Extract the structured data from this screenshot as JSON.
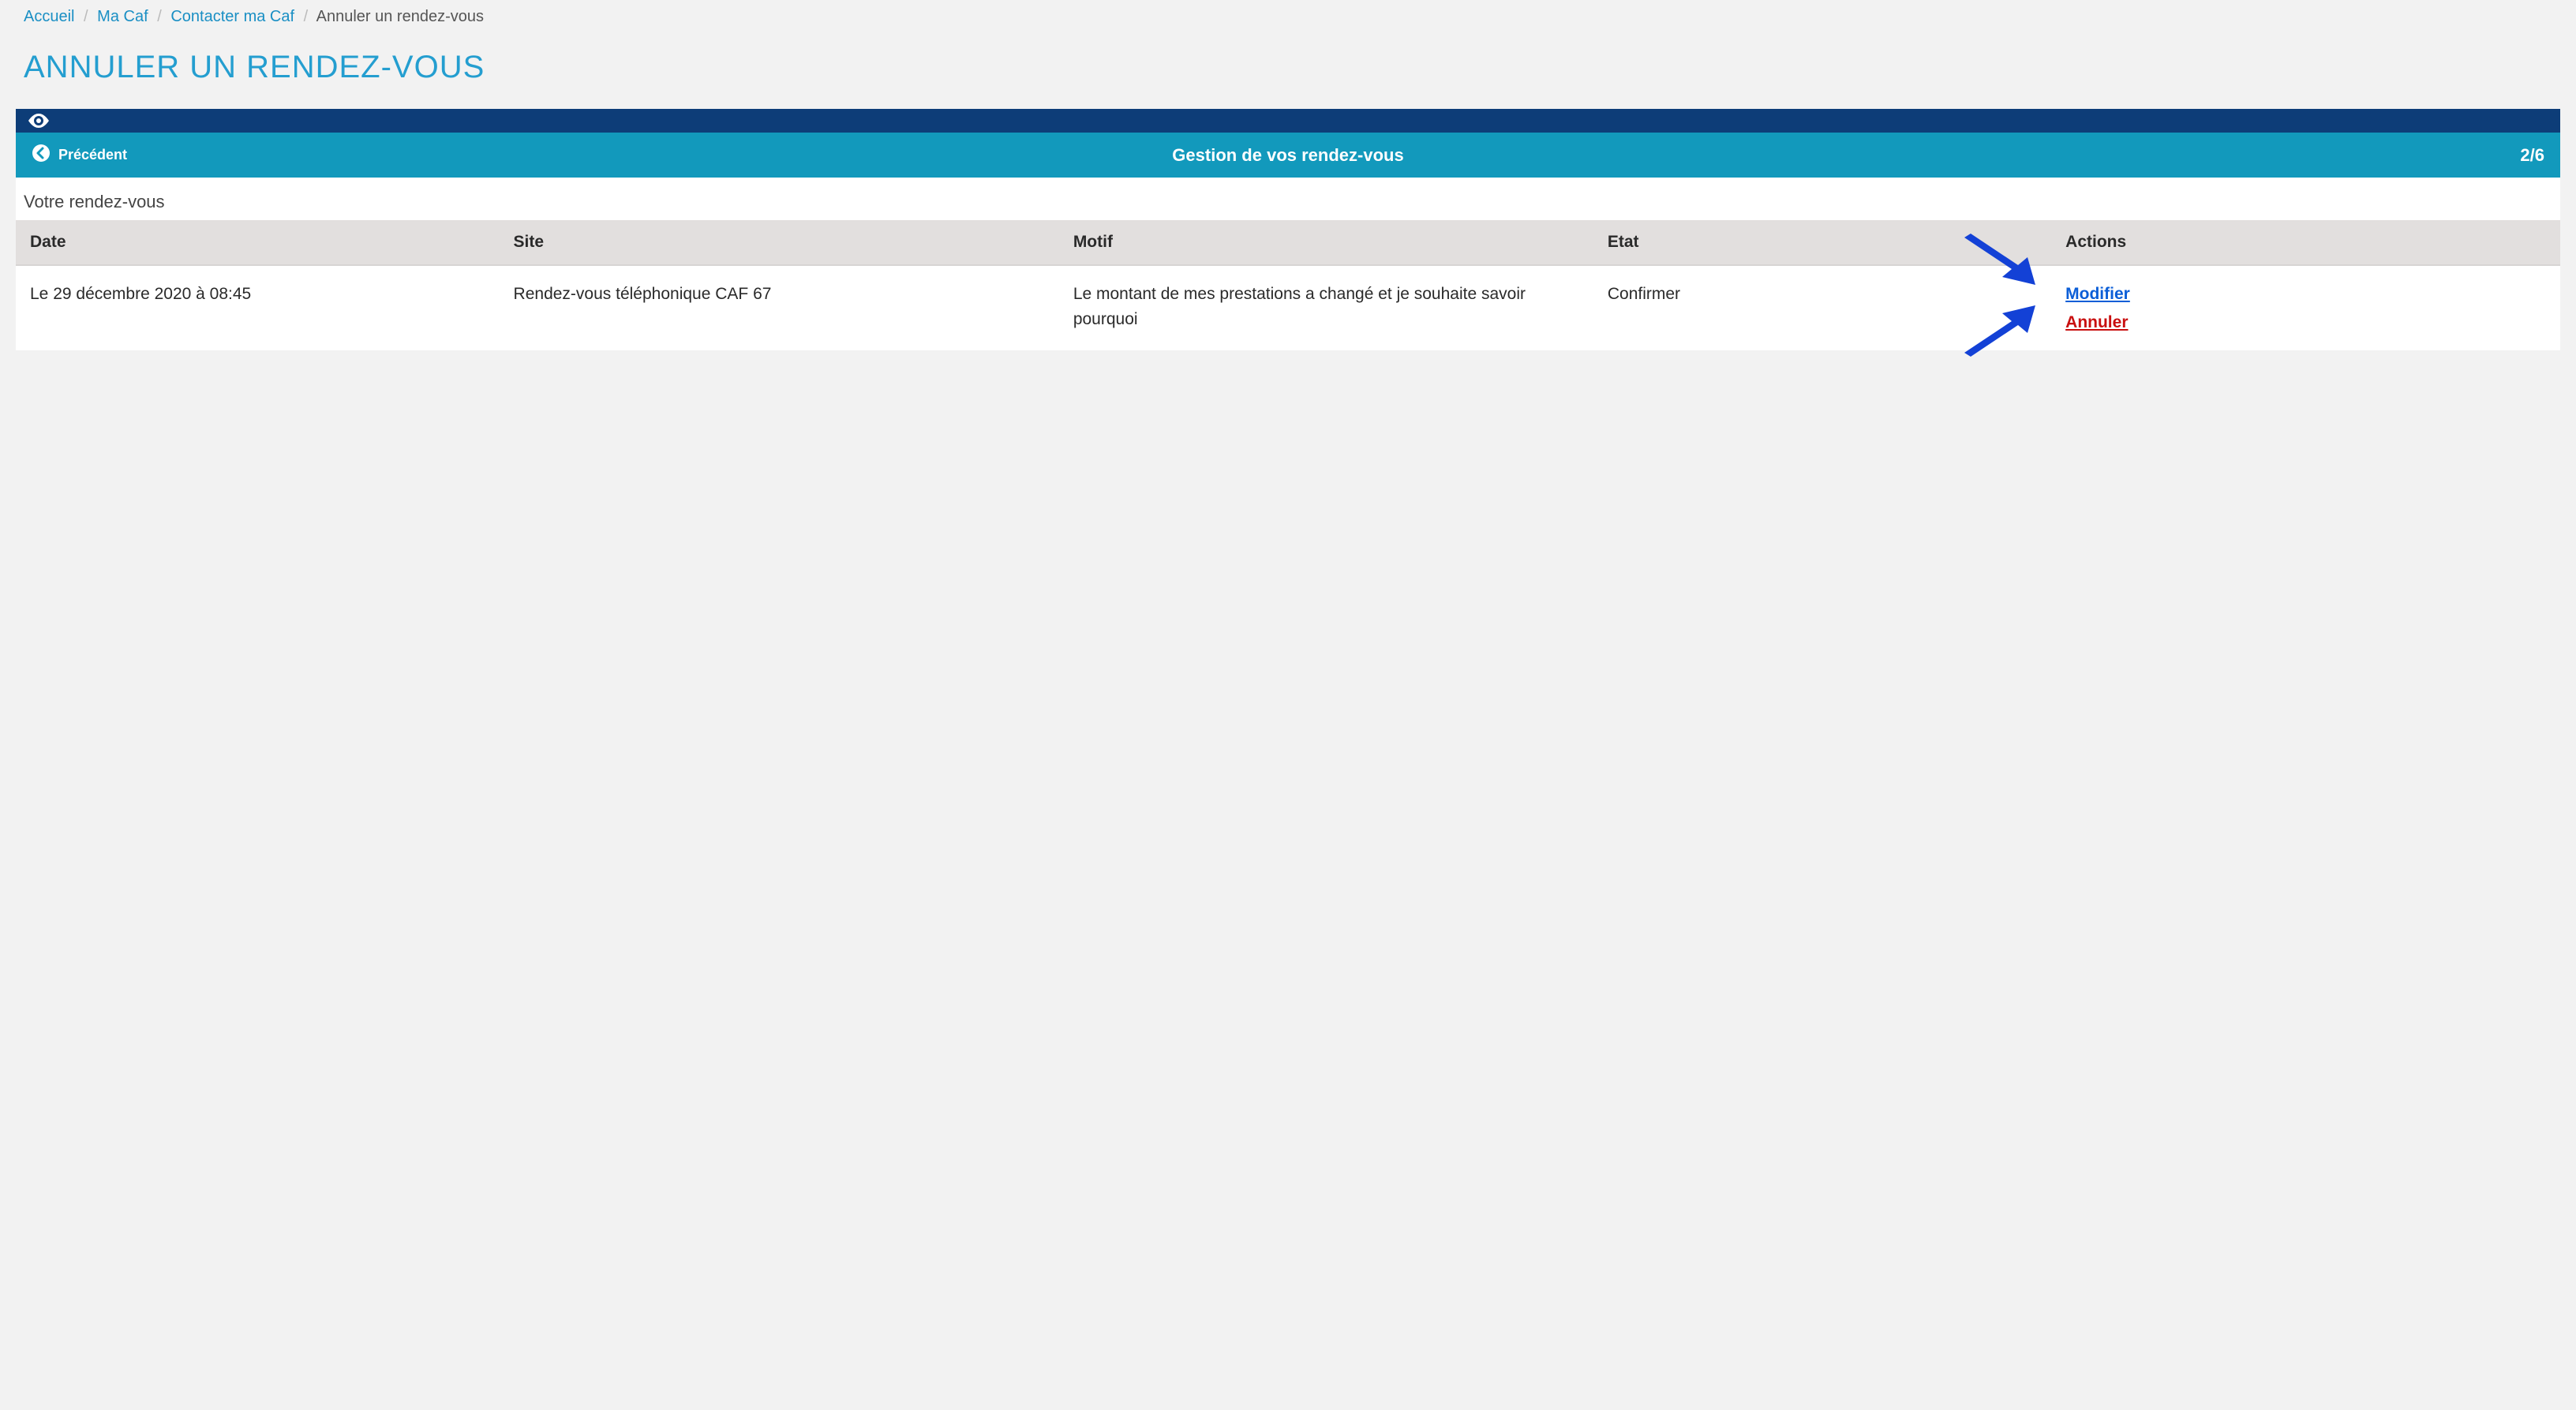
{
  "breadcrumb": {
    "items": [
      "Accueil",
      "Ma Caf",
      "Contacter ma Caf"
    ],
    "current": "Annuler un rendez-vous"
  },
  "page_title": "ANNULER UN RENDEZ-VOUS",
  "header": {
    "back_label": "Précédent",
    "center_title": "Gestion de vos rendez-vous",
    "step": "2/6"
  },
  "section_label": "Votre rendez-vous",
  "table": {
    "headers": {
      "date": "Date",
      "site": "Site",
      "motif": "Motif",
      "etat": "Etat",
      "actions": "Actions"
    },
    "row": {
      "date": "Le 29 décembre 2020 à 08:45",
      "site": "Rendez-vous téléphonique CAF 67",
      "motif": "Le montant de mes prestations a changé et je souhaite savoir pourquoi",
      "etat": "Confirmer",
      "modify_label": "Modifier",
      "cancel_label": "Annuler"
    }
  },
  "colors": {
    "accent": "#1a8fc4",
    "dark_bar": "#0d3d78",
    "mid_bar": "#1299bc",
    "link_blue": "#0b5ed7",
    "link_red": "#c90f0f",
    "arrow": "#1341d6"
  }
}
